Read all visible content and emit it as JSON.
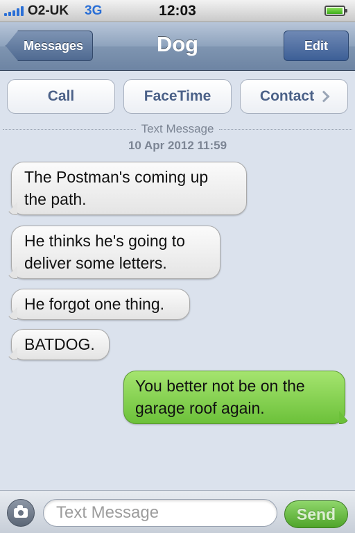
{
  "status_bar": {
    "carrier": "O2-UK",
    "network": "3G",
    "time": "12:03",
    "signal_bars": 5,
    "battery_level": 0.9
  },
  "nav": {
    "back_label": "Messages",
    "title": "Dog",
    "edit_label": "Edit"
  },
  "actions": {
    "call_label": "Call",
    "facetime_label": "FaceTime",
    "contact_label": "Contact"
  },
  "conversation": {
    "header_label": "Text Message",
    "timestamp": "10 Apr 2012 11:59",
    "messages": [
      {
        "sender": "contact",
        "lines": [
          "The Postman's coming up",
          "the path."
        ]
      },
      {
        "sender": "contact",
        "lines": [
          "He thinks he's going to",
          "deliver some letters."
        ]
      },
      {
        "sender": "contact",
        "lines": [
          "He forgot one thing."
        ]
      },
      {
        "sender": "contact",
        "lines": [
          "BATDOG."
        ]
      },
      {
        "sender": "me",
        "lines": [
          "You better not be on the",
          "garage roof again."
        ]
      }
    ]
  },
  "compose": {
    "placeholder": "Text Message",
    "send_label": "Send",
    "camera_icon": "camera-icon"
  },
  "colors": {
    "signal": "#2a6fd6",
    "network": "#2a6fd6",
    "nav_bar": "#7f95b1",
    "incoming_bubble": "#e4e4e4",
    "outgoing_bubble": "#6cc13a",
    "send_button": "#4fa52a",
    "action_text": "#4b6188"
  }
}
